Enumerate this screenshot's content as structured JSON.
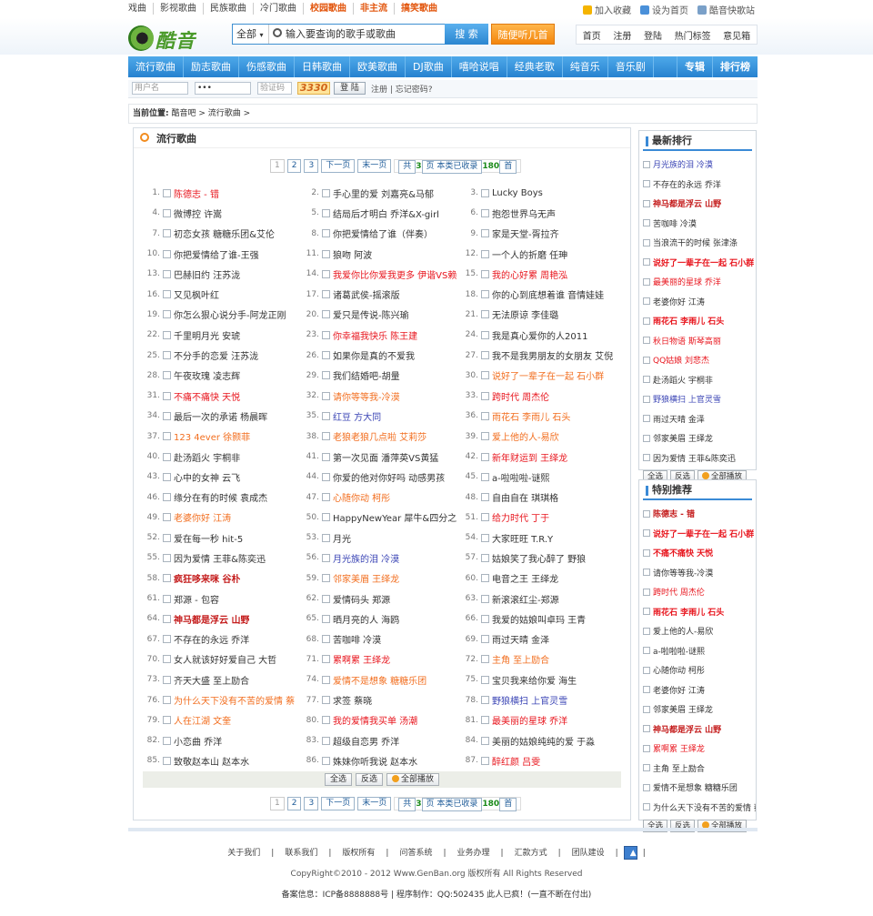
{
  "topnav": [
    "戏曲",
    "影视歌曲",
    "民族歌曲",
    "冷门歌曲",
    "校园歌曲",
    "非主流",
    "搞笑歌曲"
  ],
  "toplinks": [
    "加入收藏",
    "设为首页",
    "酷音快歌站"
  ],
  "logo": "酷音吧",
  "search": {
    "category": "全部",
    "placeholder": "输入要查询的歌手或歌曲",
    "button": "搜 索"
  },
  "listen_button": "随便听几首",
  "header_nav": [
    "首页",
    "注册",
    "登陆",
    "热门标签",
    "意见箱"
  ],
  "main_nav": [
    "流行歌曲",
    "励志歌曲",
    "伤感歌曲",
    "日韩歌曲",
    "欧美歌曲",
    "DJ歌曲",
    "嘻哈说唱",
    "经典老歌",
    "纯音乐",
    "音乐剧"
  ],
  "main_nav_right": [
    "专辑",
    "排行榜"
  ],
  "login": {
    "user_placeholder": "用户名",
    "pass_value": "•••",
    "code_placeholder": "验证码",
    "captcha": "3330",
    "button": "登 陆",
    "links": "注册 | 忘记密码?"
  },
  "breadcrumb": {
    "label": "当前位置:",
    "path": "酷音吧 > 流行歌曲 >"
  },
  "section_title": "流行歌曲",
  "pager": {
    "pages": [
      "1",
      "2",
      "3"
    ],
    "next": "下一页",
    "last": "末一页",
    "info_prefix": "共",
    "total_pages": "3",
    "info_mid": "页 本类已收录",
    "count": "180",
    "info_suffix": "首"
  },
  "songs": [
    {
      "n": "1.",
      "t": "陈德志 - 错",
      "c": "red"
    },
    {
      "n": "2.",
      "t": "手心里的爱 刘嘉亮&马郁",
      "c": "blk"
    },
    {
      "n": "3.",
      "t": "Lucky Boys",
      "c": "blk"
    },
    {
      "n": "4.",
      "t": "微博控 许嵩",
      "c": "blk"
    },
    {
      "n": "5.",
      "t": "结局后才明白 乔洋&X-girl",
      "c": "blk"
    },
    {
      "n": "6.",
      "t": "抱怨世界乌无声",
      "c": "blk"
    },
    {
      "n": "7.",
      "t": "初恋女孩 糖糖乐团&艾伦",
      "c": "blk"
    },
    {
      "n": "8.",
      "t": "你把爱情给了谁（伴奏）",
      "c": "blk"
    },
    {
      "n": "9.",
      "t": "家是天堂-胥拉齐",
      "c": "blk"
    },
    {
      "n": "10.",
      "t": "你把爱情给了谁-王强",
      "c": "blk"
    },
    {
      "n": "11.",
      "t": "狼吻 阿波",
      "c": "blk"
    },
    {
      "n": "12.",
      "t": "一个人的折磨 任珅",
      "c": "blk"
    },
    {
      "n": "13.",
      "t": "巴赫旧约 汪苏泷",
      "c": "blk"
    },
    {
      "n": "14.",
      "t": "我爱你比你爱我更多 伊谐VS赖",
      "c": "red"
    },
    {
      "n": "15.",
      "t": "我的心好累 周艳泓",
      "c": "red"
    },
    {
      "n": "16.",
      "t": "又见枫叶红",
      "c": "blk"
    },
    {
      "n": "17.",
      "t": "诸葛武侯-摇滚版",
      "c": "blk"
    },
    {
      "n": "18.",
      "t": "你的心到底想着谁 音情娃娃",
      "c": "blk"
    },
    {
      "n": "19.",
      "t": "你怎么狠心说分手-阿龙正刚",
      "c": "blk"
    },
    {
      "n": "20.",
      "t": "爱只是传说-陈兴瑜",
      "c": "blk"
    },
    {
      "n": "21.",
      "t": "无法原谅 李佳璐",
      "c": "blk"
    },
    {
      "n": "22.",
      "t": "千里明月光 安琥",
      "c": "blk"
    },
    {
      "n": "23.",
      "t": "你幸福我快乐 陈王建",
      "c": "red"
    },
    {
      "n": "24.",
      "t": "我是真心爱你的人2011",
      "c": "blk"
    },
    {
      "n": "25.",
      "t": "不分手的恋爱 汪苏泷",
      "c": "blk"
    },
    {
      "n": "26.",
      "t": "如果你是真的不爱我",
      "c": "blk"
    },
    {
      "n": "27.",
      "t": "我不是我男朋友的女朋友 艾倪",
      "c": "blk"
    },
    {
      "n": "28.",
      "t": "午夜玫瑰 凌志辉",
      "c": "blk"
    },
    {
      "n": "29.",
      "t": "我们结婚吧-胡量",
      "c": "blk"
    },
    {
      "n": "30.",
      "t": "说好了一辈子在一起 石小群",
      "c": "org"
    },
    {
      "n": "31.",
      "t": "不痛不痛快 天悦",
      "c": "red"
    },
    {
      "n": "32.",
      "t": "请你等等我-冷漠",
      "c": "org"
    },
    {
      "n": "33.",
      "t": "跨时代 周杰伦",
      "c": "red"
    },
    {
      "n": "34.",
      "t": "最后一次的承诺 杨晨晖",
      "c": "blk"
    },
    {
      "n": "35.",
      "t": "红豆 方大同",
      "c": "blue"
    },
    {
      "n": "36.",
      "t": "雨花石 李雨儿 石头",
      "c": "org"
    },
    {
      "n": "37.",
      "t": "123 4ever 徐颢菲",
      "c": "org"
    },
    {
      "n": "38.",
      "t": "老狼老狼几点啦 艾莉莎",
      "c": "org"
    },
    {
      "n": "39.",
      "t": "爱上他的人-易欣",
      "c": "org"
    },
    {
      "n": "40.",
      "t": "赴汤蹈火 宇桐非",
      "c": "blk"
    },
    {
      "n": "41.",
      "t": "第一次见面 潘萍英VS黄猛",
      "c": "blk"
    },
    {
      "n": "42.",
      "t": "新年财运到 王绎龙",
      "c": "red"
    },
    {
      "n": "43.",
      "t": "心中的女神 云飞",
      "c": "blk"
    },
    {
      "n": "44.",
      "t": "你爱的他对你好吗 动感男孩",
      "c": "blk"
    },
    {
      "n": "45.",
      "t": "a-啦啦啦-谜熙",
      "c": "blk"
    },
    {
      "n": "46.",
      "t": "缘分在有的时候 袁成杰",
      "c": "blk"
    },
    {
      "n": "47.",
      "t": "心随你动 柯彤",
      "c": "org"
    },
    {
      "n": "48.",
      "t": "自由自在 琪琪格",
      "c": "blk"
    },
    {
      "n": "49.",
      "t": "老婆你好 江涛",
      "c": "org"
    },
    {
      "n": "50.",
      "t": "HappyNewYear 犀牛&四分之",
      "c": "blk"
    },
    {
      "n": "51.",
      "t": "给力时代 丁于",
      "c": "red"
    },
    {
      "n": "52.",
      "t": "爱在每一秒 hit-5",
      "c": "blk"
    },
    {
      "n": "53.",
      "t": "月光",
      "c": "blk"
    },
    {
      "n": "54.",
      "t": "大家旺旺 T.R.Y",
      "c": "blk"
    },
    {
      "n": "55.",
      "t": "因为爱情 王菲&陈奕迅",
      "c": "blk"
    },
    {
      "n": "56.",
      "t": "月光族的泪 冷漠",
      "c": "blue"
    },
    {
      "n": "57.",
      "t": "姑娘笑了我心醉了 野狼",
      "c": "blk"
    },
    {
      "n": "58.",
      "t": "疯狂哆来咪 谷朴",
      "c": "dred"
    },
    {
      "n": "59.",
      "t": "邻家美眉 王绎龙",
      "c": "org"
    },
    {
      "n": "60.",
      "t": "电音之王 王绎龙",
      "c": "blk"
    },
    {
      "n": "61.",
      "t": "郑源 - 包容",
      "c": "blk"
    },
    {
      "n": "62.",
      "t": "爱情码头 郑源",
      "c": "blk"
    },
    {
      "n": "63.",
      "t": "新滚滚红尘-郑源",
      "c": "blk"
    },
    {
      "n": "64.",
      "t": "神马都是浮云 山野",
      "c": "dred"
    },
    {
      "n": "65.",
      "t": "晒月亮的人 海鸥",
      "c": "blk"
    },
    {
      "n": "66.",
      "t": "我爱的姑娘叫卓玛 王青",
      "c": "blk"
    },
    {
      "n": "67.",
      "t": "不存在的永远 乔洋",
      "c": "blk"
    },
    {
      "n": "68.",
      "t": "苦咖啡 冷漠",
      "c": "blk"
    },
    {
      "n": "69.",
      "t": "雨过天晴 金泽",
      "c": "blk"
    },
    {
      "n": "70.",
      "t": "女人就该好好爱自己 大哲",
      "c": "blk"
    },
    {
      "n": "71.",
      "t": "累啊累 王绎龙",
      "c": "red"
    },
    {
      "n": "72.",
      "t": "主角 至上励合",
      "c": "org"
    },
    {
      "n": "73.",
      "t": "齐天大盛 至上励合",
      "c": "blk"
    },
    {
      "n": "74.",
      "t": "爱情不是想象 糖糖乐团",
      "c": "org"
    },
    {
      "n": "75.",
      "t": "宝贝我来给你爱 海生",
      "c": "blk"
    },
    {
      "n": "76.",
      "t": "为什么天下没有不苦的爱情 蔡",
      "c": "org"
    },
    {
      "n": "77.",
      "t": "求签 蔡晓",
      "c": "blk"
    },
    {
      "n": "78.",
      "t": "野狼横扫 上官灵雪",
      "c": "blue"
    },
    {
      "n": "79.",
      "t": "人在江湖 文奎",
      "c": "org"
    },
    {
      "n": "80.",
      "t": "我的爱情我买单 汤潮",
      "c": "red"
    },
    {
      "n": "81.",
      "t": "最美丽的星球 乔洋",
      "c": "red"
    },
    {
      "n": "82.",
      "t": "小恋曲 乔洋",
      "c": "blk"
    },
    {
      "n": "83.",
      "t": "超级自恋男 乔洋",
      "c": "blk"
    },
    {
      "n": "84.",
      "t": "美丽的姑娘纯纯的爱 于淼",
      "c": "blk"
    },
    {
      "n": "85.",
      "t": "致敬赵本山 赵本水",
      "c": "blk"
    },
    {
      "n": "86.",
      "t": "姝妹你听我说 赵本水",
      "c": "blk"
    },
    {
      "n": "87.",
      "t": "醉红颜 吕雯",
      "c": "red"
    }
  ],
  "actions": {
    "select_all": "全选",
    "invert": "反选",
    "play_all": "全部播放"
  },
  "side_latest": {
    "title": "最新排行",
    "items": [
      {
        "t": "月光族的泪 冷漠",
        "c": "blue"
      },
      {
        "t": "不存在的永远 乔洋",
        "c": "blk"
      },
      {
        "t": "神马都是浮云 山野",
        "c": "dred"
      },
      {
        "t": "苦咖啡 冷漠",
        "c": "blk"
      },
      {
        "t": "当浪流干的时候 张津涤",
        "c": "blk"
      },
      {
        "t": "说好了一辈子在一起 石小群",
        "c": "bred"
      },
      {
        "t": "最美丽的星球 乔洋",
        "c": "red"
      },
      {
        "t": "老婆你好 江涛",
        "c": "blk"
      },
      {
        "t": "雨花石 李雨儿 石头",
        "c": "bred"
      },
      {
        "t": "秋日物语 斯琴高丽",
        "c": "red"
      },
      {
        "t": "QQ姑娘 刘悲杰",
        "c": "red"
      },
      {
        "t": "赴汤蹈火 宇桐非",
        "c": "blk"
      },
      {
        "t": "野狼横扫 上官灵雪",
        "c": "blue"
      },
      {
        "t": "雨过天晴 金泽",
        "c": "blk"
      },
      {
        "t": "邻家美眉 王绎龙",
        "c": "blk"
      },
      {
        "t": "因为爱情 王菲&陈奕迅",
        "c": "blk"
      }
    ]
  },
  "side_special": {
    "title": "特别推荐",
    "items": [
      {
        "t": "陈德志 - 错",
        "c": "dred"
      },
      {
        "t": "说好了一辈子在一起 石小群",
        "c": "bred"
      },
      {
        "t": "不痛不痛快 天悦",
        "c": "bred"
      },
      {
        "t": "请你等等我-冷漠",
        "c": "blk"
      },
      {
        "t": "跨时代 周杰伦",
        "c": "red"
      },
      {
        "t": "雨花石 李雨儿 石头",
        "c": "bred"
      },
      {
        "t": "爱上他的人-易欣",
        "c": "blk"
      },
      {
        "t": "a-啦啦啦-谜熙",
        "c": "blk"
      },
      {
        "t": "心随你动 柯彤",
        "c": "blk"
      },
      {
        "t": "老婆你好 江涛",
        "c": "blk"
      },
      {
        "t": "邻家美眉 王绎龙",
        "c": "blk"
      },
      {
        "t": "神马都是浮云 山野",
        "c": "dred"
      },
      {
        "t": "累啊累 王绎龙",
        "c": "red"
      },
      {
        "t": "主角 至上励合",
        "c": "blk"
      },
      {
        "t": "爱情不是想象 糖糖乐团",
        "c": "blk"
      },
      {
        "t": "为什么天下没有不苦的爱情 蔡",
        "c": "blk"
      }
    ]
  },
  "footer": {
    "links": [
      "关于我们",
      "联系我们",
      "版权所有",
      "问答系统",
      "业务办理",
      "汇款方式",
      "团队建设"
    ],
    "copyright": "CopyRight©2010 - 2012 Www.GenBan.org 版权所有 All Rights Reserved",
    "beian": "备案信息：ICP备8888888号  |  程序制作：QQ:502435 此人已疯！(一直不断在付出)"
  }
}
